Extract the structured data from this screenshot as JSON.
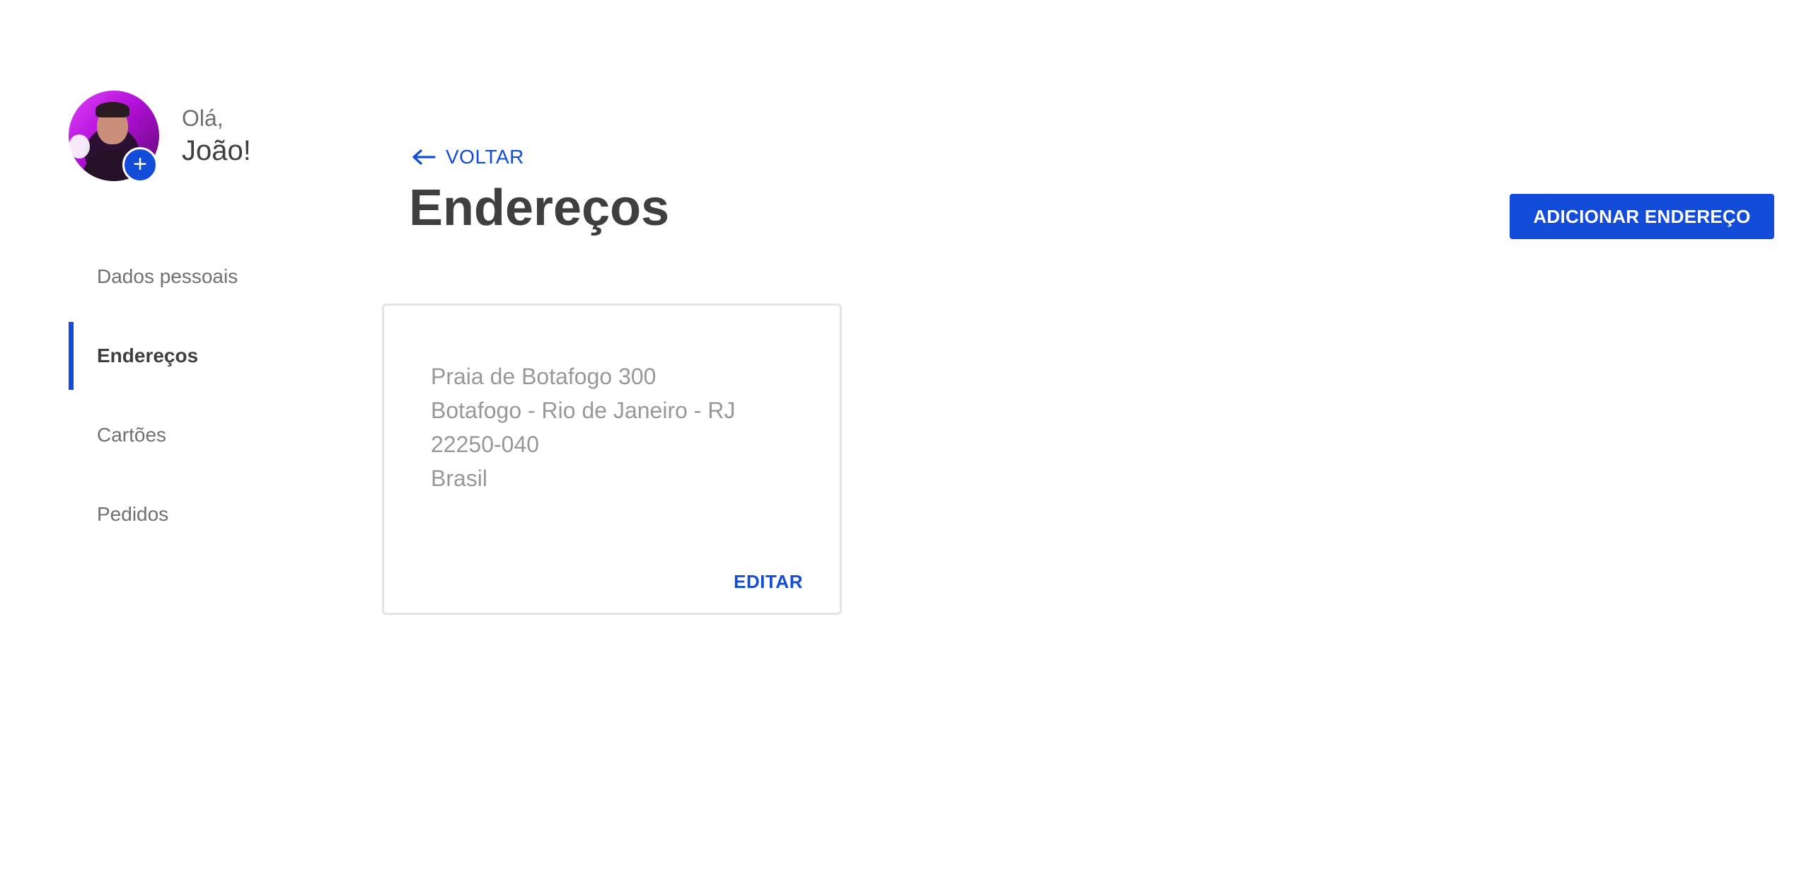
{
  "user": {
    "greeting": "Olá,",
    "name": "João!",
    "avatar_add_icon": "plus-icon"
  },
  "sidebar": {
    "items": [
      {
        "label": "Dados pessoais",
        "active": false
      },
      {
        "label": "Endereços",
        "active": true
      },
      {
        "label": "Cartões",
        "active": false
      },
      {
        "label": "Pedidos",
        "active": false
      }
    ]
  },
  "header": {
    "back_label": "VOLTAR",
    "back_icon": "arrow-left-icon",
    "title": "Endereços",
    "add_button_label": "ADICIONAR ENDEREÇO"
  },
  "addresses": [
    {
      "lines": [
        "Praia de Botafogo 300",
        "Botafogo - Rio de Janeiro - RJ",
        "22250-040",
        "Brasil"
      ],
      "edit_label": "EDITAR"
    }
  ],
  "colors": {
    "accent": "#134cd8",
    "text_primary": "#3f3f40",
    "text_secondary": "#707070",
    "text_muted": "#979899",
    "card_border": "#e4e4e4"
  }
}
